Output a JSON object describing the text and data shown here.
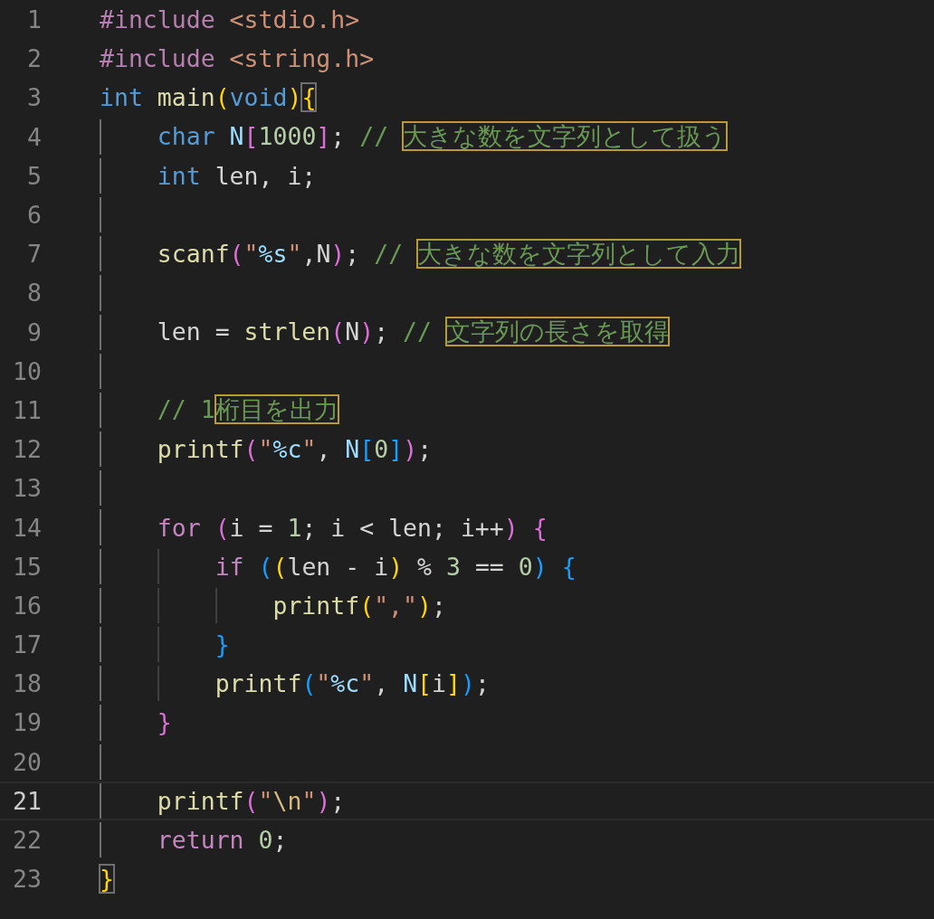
{
  "editor": {
    "lines": [
      {
        "number": "1",
        "current": false,
        "tokens": [
          {
            "kind": "directive",
            "text": "#include "
          },
          {
            "kind": "string",
            "text": "<stdio.h>"
          }
        ]
      },
      {
        "number": "2",
        "current": false,
        "tokens": [
          {
            "kind": "directive",
            "text": "#include "
          },
          {
            "kind": "string",
            "text": "<string.h>"
          }
        ]
      },
      {
        "number": "3",
        "current": false,
        "tokens": [
          {
            "kind": "type",
            "text": "int "
          },
          {
            "kind": "func",
            "text": "main"
          },
          {
            "kind": "paren1",
            "text": "("
          },
          {
            "kind": "type",
            "text": "void"
          },
          {
            "kind": "paren1",
            "text": ")"
          },
          {
            "kind": "paren1",
            "text": "{",
            "highlighted": true
          }
        ]
      },
      {
        "number": "4",
        "current": false,
        "tokens": [
          {
            "kind": "type",
            "text": "    char "
          },
          {
            "kind": "var",
            "text": "N"
          },
          {
            "kind": "paren2",
            "text": "["
          },
          {
            "kind": "num",
            "text": "1000"
          },
          {
            "kind": "paren2",
            "text": "]"
          },
          {
            "kind": "plain",
            "text": "; "
          },
          {
            "kind": "comment",
            "text": "// "
          },
          {
            "kind": "comment",
            "text": "大きな数を文字列として扱う",
            "highlighted": true
          }
        ]
      },
      {
        "number": "5",
        "current": false,
        "tokens": [
          {
            "kind": "type",
            "text": "    int"
          },
          {
            "kind": "plain",
            "text": " len, i;"
          }
        ]
      },
      {
        "number": "6",
        "current": false
      },
      {
        "number": "7",
        "current": false,
        "tokens": [
          {
            "kind": "func",
            "text": "    scanf"
          },
          {
            "kind": "paren2",
            "text": "("
          },
          {
            "kind": "string",
            "text": "\""
          },
          {
            "kind": "format",
            "text": "%s"
          },
          {
            "kind": "string",
            "text": "\""
          },
          {
            "kind": "plain",
            "text": ",N"
          },
          {
            "kind": "paren2",
            "text": ")"
          },
          {
            "kind": "plain",
            "text": "; "
          },
          {
            "kind": "comment",
            "text": "// "
          },
          {
            "kind": "comment",
            "text": "大きな数を文字列として入力",
            "highlighted": true
          }
        ]
      },
      {
        "number": "8",
        "current": false
      },
      {
        "number": "9",
        "current": false,
        "tokens": [
          {
            "kind": "plain",
            "text": "    len = "
          },
          {
            "kind": "func",
            "text": "strlen"
          },
          {
            "kind": "paren2",
            "text": "("
          },
          {
            "kind": "plain",
            "text": "N"
          },
          {
            "kind": "paren2",
            "text": ")"
          },
          {
            "kind": "plain",
            "text": "; "
          },
          {
            "kind": "comment",
            "text": "// "
          },
          {
            "kind": "comment",
            "text": "文字列の長さを取得",
            "highlighted": true
          }
        ]
      },
      {
        "number": "10",
        "current": false
      },
      {
        "number": "11",
        "current": false,
        "tokens": [
          {
            "kind": "comment",
            "text": "    // 1"
          },
          {
            "kind": "comment",
            "text": "桁目を出力",
            "highlighted": true
          }
        ]
      },
      {
        "number": "12",
        "current": false,
        "tokens": [
          {
            "kind": "func",
            "text": "    printf"
          },
          {
            "kind": "paren2",
            "text": "("
          },
          {
            "kind": "string",
            "text": "\""
          },
          {
            "kind": "format",
            "text": "%c"
          },
          {
            "kind": "string",
            "text": "\""
          },
          {
            "kind": "plain",
            "text": ", "
          },
          {
            "kind": "var",
            "text": "N"
          },
          {
            "kind": "paren3",
            "text": "["
          },
          {
            "kind": "num",
            "text": "0"
          },
          {
            "kind": "paren3",
            "text": "]"
          },
          {
            "kind": "paren2",
            "text": ")"
          },
          {
            "kind": "plain",
            "text": ";"
          }
        ]
      },
      {
        "number": "13",
        "current": false
      },
      {
        "number": "14",
        "current": false,
        "tokens": [
          {
            "kind": "keyword",
            "text": "    for "
          },
          {
            "kind": "paren2",
            "text": "("
          },
          {
            "kind": "plain",
            "text": "i = "
          },
          {
            "kind": "num",
            "text": "1"
          },
          {
            "kind": "plain",
            "text": "; i < len; i++"
          },
          {
            "kind": "paren2",
            "text": ")"
          },
          {
            "kind": "paren2",
            "text": " {"
          }
        ]
      },
      {
        "number": "15",
        "current": false,
        "tokens": [
          {
            "kind": "keyword",
            "text": "        if "
          },
          {
            "kind": "paren3",
            "text": "("
          },
          {
            "kind": "paren1",
            "text": "("
          },
          {
            "kind": "plain",
            "text": "len - i"
          },
          {
            "kind": "paren1",
            "text": ")"
          },
          {
            "kind": "plain",
            "text": " % "
          },
          {
            "kind": "num",
            "text": "3"
          },
          {
            "kind": "plain",
            "text": " == "
          },
          {
            "kind": "num",
            "text": "0"
          },
          {
            "kind": "paren3",
            "text": ")"
          },
          {
            "kind": "paren3",
            "text": " {"
          }
        ]
      },
      {
        "number": "16",
        "current": false,
        "tokens": [
          {
            "kind": "func",
            "text": "            printf"
          },
          {
            "kind": "paren1",
            "text": "("
          },
          {
            "kind": "string",
            "text": "\",\""
          },
          {
            "kind": "paren1",
            "text": ")"
          },
          {
            "kind": "plain",
            "text": ";"
          }
        ]
      },
      {
        "number": "17",
        "current": false,
        "tokens": [
          {
            "kind": "paren3",
            "text": "        }"
          }
        ]
      },
      {
        "number": "18",
        "current": false,
        "tokens": [
          {
            "kind": "func",
            "text": "        printf"
          },
          {
            "kind": "paren3",
            "text": "("
          },
          {
            "kind": "string",
            "text": "\""
          },
          {
            "kind": "format",
            "text": "%c"
          },
          {
            "kind": "string",
            "text": "\""
          },
          {
            "kind": "plain",
            "text": ", "
          },
          {
            "kind": "var",
            "text": "N"
          },
          {
            "kind": "paren1",
            "text": "["
          },
          {
            "kind": "plain",
            "text": "i"
          },
          {
            "kind": "paren1",
            "text": "]"
          },
          {
            "kind": "paren3",
            "text": ")"
          },
          {
            "kind": "plain",
            "text": ";"
          }
        ]
      },
      {
        "number": "19",
        "current": false,
        "tokens": [
          {
            "kind": "paren2",
            "text": "    }"
          }
        ]
      },
      {
        "number": "20",
        "current": false
      },
      {
        "number": "21",
        "current": true,
        "tokens": [
          {
            "kind": "func",
            "text": "    printf"
          },
          {
            "kind": "paren2",
            "text": "("
          },
          {
            "kind": "string",
            "text": "\""
          },
          {
            "kind": "escape",
            "text": "\\n"
          },
          {
            "kind": "string",
            "text": "\""
          },
          {
            "kind": "paren2",
            "text": ")"
          },
          {
            "kind": "plain",
            "text": ";"
          }
        ]
      },
      {
        "number": "22",
        "current": false,
        "tokens": [
          {
            "kind": "keyword",
            "text": "    return "
          },
          {
            "kind": "num",
            "text": "0"
          },
          {
            "kind": "plain",
            "text": ";"
          }
        ]
      },
      {
        "number": "23",
        "current": false,
        "tokens": [
          {
            "kind": "paren1",
            "text": "}",
            "highlighted": true
          }
        ]
      }
    ]
  }
}
